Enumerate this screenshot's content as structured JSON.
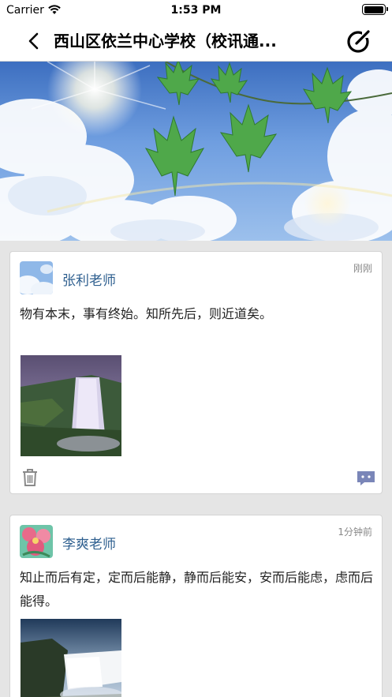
{
  "status_bar": {
    "carrier": "Carrier",
    "time": "1:53 PM",
    "battery_level": 1.0
  },
  "nav": {
    "title": "西山区依兰中心学校（校讯通...",
    "back_icon": "chevron-left-icon",
    "compose_icon": "compose-circle-icon"
  },
  "posts": [
    {
      "author": "张利老师",
      "time": "刚刚",
      "content": "物有本末，事有终始。知所先后，则近道矣。",
      "image": "waterfall-photo",
      "avatar": "sky-avatar"
    },
    {
      "author": "李爽老师",
      "time": "1分钟前",
      "content": "知止而后有定，定而后能静，静而后能安，安而后能虑，虑而后能得。",
      "image": "waterfall-photo",
      "avatar": "flower-avatar"
    }
  ],
  "colors": {
    "author_name": "#2e5f8f",
    "comment_icon": "#7a86b8",
    "page_background": "#e5e5e5"
  }
}
